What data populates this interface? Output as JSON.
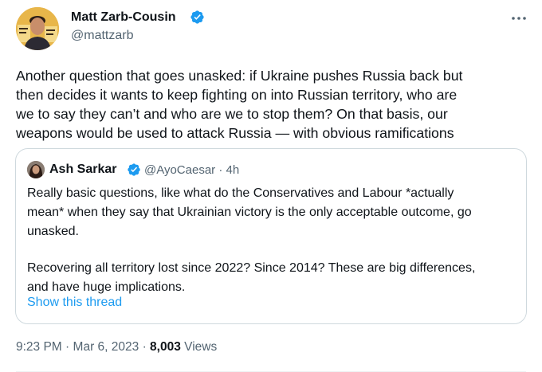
{
  "tweet": {
    "author": {
      "name": "Matt Zarb-Cousin",
      "handle": "@mattzarb",
      "verified": true
    },
    "text_lines": [
      "Another question that goes unasked: if Ukraine pushes Russia back but",
      "then decides it wants to keep fighting on into Russian territory, who are",
      "we to say they can’t and who are we to stop them? On that basis, our",
      "weapons would be used to attack Russia — with obvious ramifications"
    ],
    "quoted": {
      "name": "Ash Sarkar",
      "handle": "@AyoCaesar",
      "separator": "·",
      "time": "4h",
      "verified": true,
      "paragraph1_lines": [
        "Really basic questions, like what do the Conservatives and Labour *actually",
        "mean* when they say that Ukrainian victory is the only acceptable outcome, go",
        "unasked."
      ],
      "paragraph2_lines": [
        "Recovering all territory lost since 2022? Since 2014? These are big differences,",
        "and have huge implications."
      ],
      "show_thread": "Show this thread"
    },
    "meta": {
      "time": "9:23 PM",
      "separator": "·",
      "date": "Mar 6, 2023",
      "views_count": "8,003",
      "views_label": "Views"
    }
  },
  "icons": {
    "verified": "verified-badge-icon",
    "more": "more-dots-icon"
  },
  "colors": {
    "verified_blue": "#1d9bf0",
    "link_blue": "#1d9bf0",
    "secondary_text": "#536471",
    "primary_text": "#0f1419",
    "border": "#cfd9de"
  }
}
